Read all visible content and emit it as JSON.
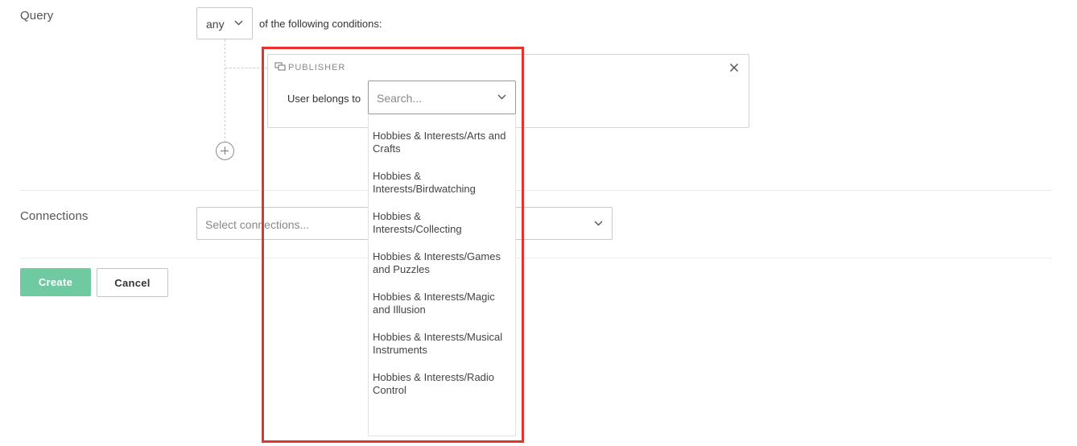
{
  "query": {
    "label": "Query",
    "match_select": {
      "value": "any"
    },
    "conditions_text": "of the following conditions:",
    "condition_card": {
      "header_label": "PUBLISHER",
      "field_label": "User belongs to",
      "search": {
        "placeholder": "Search..."
      },
      "options": [
        "Hobbies & Interests/Arts and Crafts",
        "Hobbies & Interests/Birdwatching",
        "Hobbies & Interests/Collecting",
        "Hobbies & Interests/Games and Puzzles",
        "Hobbies & Interests/Magic and Illusion",
        "Hobbies & Interests/Musical Instruments",
        "Hobbies & Interests/Radio Control"
      ]
    }
  },
  "connections": {
    "label": "Connections",
    "placeholder": "Select connections..."
  },
  "actions": {
    "create_label": "Create",
    "cancel_label": "Cancel"
  },
  "colors": {
    "primary": "#6fcaa2",
    "highlight": "#e8322c"
  },
  "icons": {
    "card_header": "publisher-icon",
    "close": "close-icon",
    "add": "add-circle-icon",
    "chevron": "chevron-down-icon"
  }
}
